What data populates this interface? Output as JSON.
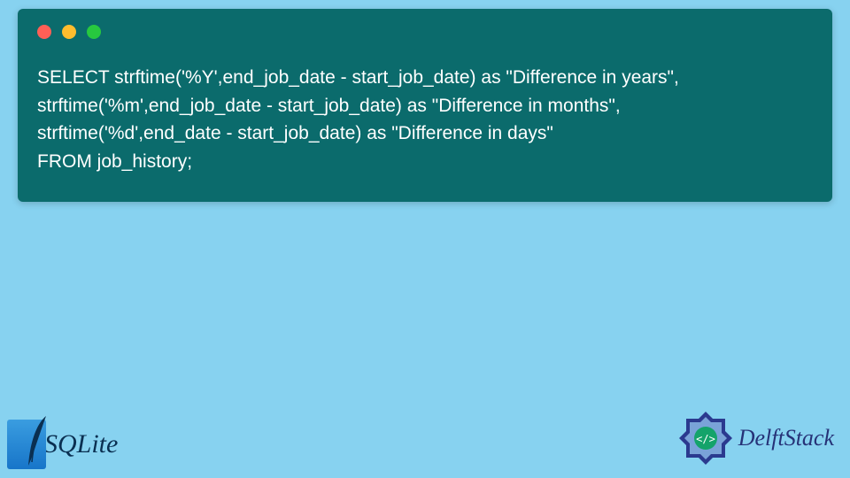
{
  "code": {
    "line1": "SELECT strftime('%Y',end_job_date - start_job_date) as \"Difference in years\",",
    "line2": "strftime('%m',end_job_date - start_job_date) as \"Difference in months\",",
    "line3": "strftime('%d',end_date - start_job_date) as \"Difference in days\"",
    "line4": "FROM job_history;"
  },
  "logos": {
    "sqlite": "SQLite",
    "delftstack": "DelftStack"
  },
  "traffic_colors": {
    "red": "#ff5f56",
    "yellow": "#ffbd2e",
    "green": "#27c93f"
  }
}
